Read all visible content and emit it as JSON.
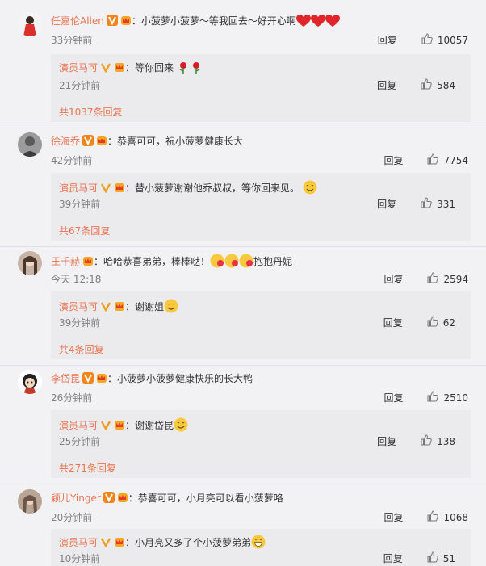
{
  "colors": {
    "name": "#eb7350",
    "background": "#f2f2f5",
    "sub_background": "#ebebee"
  },
  "reply_label": "回复",
  "comments": [
    {
      "name": "任嘉伦Allen",
      "text": "：小菠萝小菠萝～等我回去～好开心啊",
      "time": "33分钟前",
      "likes": "10057",
      "avatar_icon": "user-avatar-red-icon",
      "sub": {
        "name": "演员马可",
        "text": "：等你回来",
        "time": "21分钟前",
        "likes": "584"
      },
      "more": "共1037条回复"
    },
    {
      "name": "徐海乔",
      "text": "：恭喜可可，祝小菠萝健康长大",
      "time": "42分钟前",
      "likes": "7754",
      "avatar_icon": "user-avatar-gray-icon",
      "sub": {
        "name": "演员马可",
        "text": "：替小菠萝谢谢他乔叔叔，等你回来见。",
        "time": "39分钟前",
        "likes": "331"
      },
      "more": "共67条回复"
    },
    {
      "name": "王千赫",
      "text": "：哈哈恭喜弟弟，棒棒哒！",
      "text2": "抱抱丹妮",
      "time": "今天 12:18",
      "likes": "2594",
      "avatar_icon": "user-avatar-woman-icon",
      "sub": {
        "name": "演员马可",
        "text": "：谢谢姐",
        "time": "39分钟前",
        "likes": "62"
      },
      "more": "共4条回复"
    },
    {
      "name": "李岱昆",
      "text": "：小菠萝小菠萝健康快乐的长大鸭",
      "time": "26分钟前",
      "likes": "2510",
      "avatar_icon": "user-avatar-cartoon-icon",
      "sub": {
        "name": "演员马可",
        "text": "：谢谢岱昆",
        "time": "25分钟前",
        "likes": "138"
      },
      "more": "共271条回复"
    },
    {
      "name": "颖儿Yinger",
      "text": "：恭喜可可，小月亮可以看小菠萝咯",
      "time": "20分钟前",
      "likes": "1068",
      "avatar_icon": "user-avatar-woman2-icon",
      "sub": {
        "name": "演员马可",
        "text": "：小月亮又多了个小菠萝弟弟",
        "time": "10分钟前",
        "likes": "51"
      },
      "more": ""
    }
  ]
}
